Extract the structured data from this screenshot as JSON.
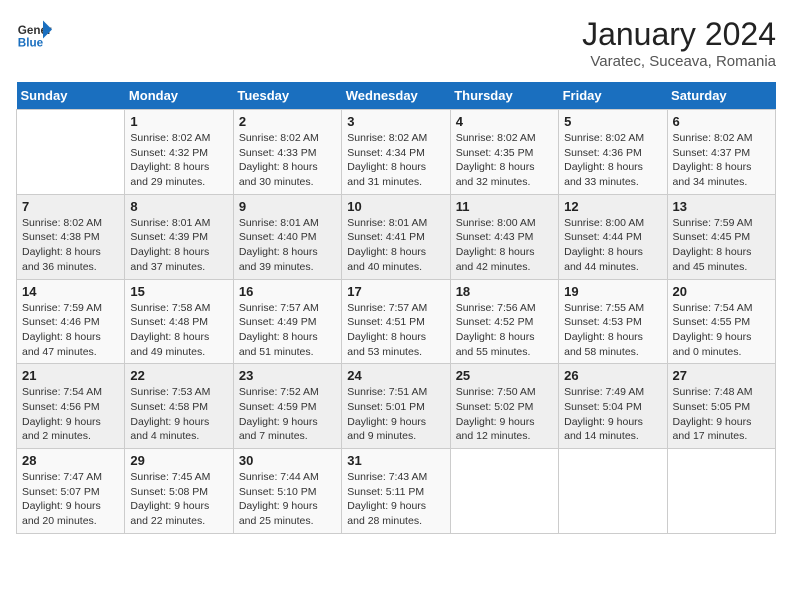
{
  "header": {
    "logo_line1": "General",
    "logo_line2": "Blue",
    "month": "January 2024",
    "location": "Varatec, Suceava, Romania"
  },
  "days_of_week": [
    "Sunday",
    "Monday",
    "Tuesday",
    "Wednesday",
    "Thursday",
    "Friday",
    "Saturday"
  ],
  "weeks": [
    [
      {
        "day": "",
        "info": ""
      },
      {
        "day": "1",
        "info": "Sunrise: 8:02 AM\nSunset: 4:32 PM\nDaylight: 8 hours\nand 29 minutes."
      },
      {
        "day": "2",
        "info": "Sunrise: 8:02 AM\nSunset: 4:33 PM\nDaylight: 8 hours\nand 30 minutes."
      },
      {
        "day": "3",
        "info": "Sunrise: 8:02 AM\nSunset: 4:34 PM\nDaylight: 8 hours\nand 31 minutes."
      },
      {
        "day": "4",
        "info": "Sunrise: 8:02 AM\nSunset: 4:35 PM\nDaylight: 8 hours\nand 32 minutes."
      },
      {
        "day": "5",
        "info": "Sunrise: 8:02 AM\nSunset: 4:36 PM\nDaylight: 8 hours\nand 33 minutes."
      },
      {
        "day": "6",
        "info": "Sunrise: 8:02 AM\nSunset: 4:37 PM\nDaylight: 8 hours\nand 34 minutes."
      }
    ],
    [
      {
        "day": "7",
        "info": "Sunrise: 8:02 AM\nSunset: 4:38 PM\nDaylight: 8 hours\nand 36 minutes."
      },
      {
        "day": "8",
        "info": "Sunrise: 8:01 AM\nSunset: 4:39 PM\nDaylight: 8 hours\nand 37 minutes."
      },
      {
        "day": "9",
        "info": "Sunrise: 8:01 AM\nSunset: 4:40 PM\nDaylight: 8 hours\nand 39 minutes."
      },
      {
        "day": "10",
        "info": "Sunrise: 8:01 AM\nSunset: 4:41 PM\nDaylight: 8 hours\nand 40 minutes."
      },
      {
        "day": "11",
        "info": "Sunrise: 8:00 AM\nSunset: 4:43 PM\nDaylight: 8 hours\nand 42 minutes."
      },
      {
        "day": "12",
        "info": "Sunrise: 8:00 AM\nSunset: 4:44 PM\nDaylight: 8 hours\nand 44 minutes."
      },
      {
        "day": "13",
        "info": "Sunrise: 7:59 AM\nSunset: 4:45 PM\nDaylight: 8 hours\nand 45 minutes."
      }
    ],
    [
      {
        "day": "14",
        "info": "Sunrise: 7:59 AM\nSunset: 4:46 PM\nDaylight: 8 hours\nand 47 minutes."
      },
      {
        "day": "15",
        "info": "Sunrise: 7:58 AM\nSunset: 4:48 PM\nDaylight: 8 hours\nand 49 minutes."
      },
      {
        "day": "16",
        "info": "Sunrise: 7:57 AM\nSunset: 4:49 PM\nDaylight: 8 hours\nand 51 minutes."
      },
      {
        "day": "17",
        "info": "Sunrise: 7:57 AM\nSunset: 4:51 PM\nDaylight: 8 hours\nand 53 minutes."
      },
      {
        "day": "18",
        "info": "Sunrise: 7:56 AM\nSunset: 4:52 PM\nDaylight: 8 hours\nand 55 minutes."
      },
      {
        "day": "19",
        "info": "Sunrise: 7:55 AM\nSunset: 4:53 PM\nDaylight: 8 hours\nand 58 minutes."
      },
      {
        "day": "20",
        "info": "Sunrise: 7:54 AM\nSunset: 4:55 PM\nDaylight: 9 hours\nand 0 minutes."
      }
    ],
    [
      {
        "day": "21",
        "info": "Sunrise: 7:54 AM\nSunset: 4:56 PM\nDaylight: 9 hours\nand 2 minutes."
      },
      {
        "day": "22",
        "info": "Sunrise: 7:53 AM\nSunset: 4:58 PM\nDaylight: 9 hours\nand 4 minutes."
      },
      {
        "day": "23",
        "info": "Sunrise: 7:52 AM\nSunset: 4:59 PM\nDaylight: 9 hours\nand 7 minutes."
      },
      {
        "day": "24",
        "info": "Sunrise: 7:51 AM\nSunset: 5:01 PM\nDaylight: 9 hours\nand 9 minutes."
      },
      {
        "day": "25",
        "info": "Sunrise: 7:50 AM\nSunset: 5:02 PM\nDaylight: 9 hours\nand 12 minutes."
      },
      {
        "day": "26",
        "info": "Sunrise: 7:49 AM\nSunset: 5:04 PM\nDaylight: 9 hours\nand 14 minutes."
      },
      {
        "day": "27",
        "info": "Sunrise: 7:48 AM\nSunset: 5:05 PM\nDaylight: 9 hours\nand 17 minutes."
      }
    ],
    [
      {
        "day": "28",
        "info": "Sunrise: 7:47 AM\nSunset: 5:07 PM\nDaylight: 9 hours\nand 20 minutes."
      },
      {
        "day": "29",
        "info": "Sunrise: 7:45 AM\nSunset: 5:08 PM\nDaylight: 9 hours\nand 22 minutes."
      },
      {
        "day": "30",
        "info": "Sunrise: 7:44 AM\nSunset: 5:10 PM\nDaylight: 9 hours\nand 25 minutes."
      },
      {
        "day": "31",
        "info": "Sunrise: 7:43 AM\nSunset: 5:11 PM\nDaylight: 9 hours\nand 28 minutes."
      },
      {
        "day": "",
        "info": ""
      },
      {
        "day": "",
        "info": ""
      },
      {
        "day": "",
        "info": ""
      }
    ]
  ]
}
